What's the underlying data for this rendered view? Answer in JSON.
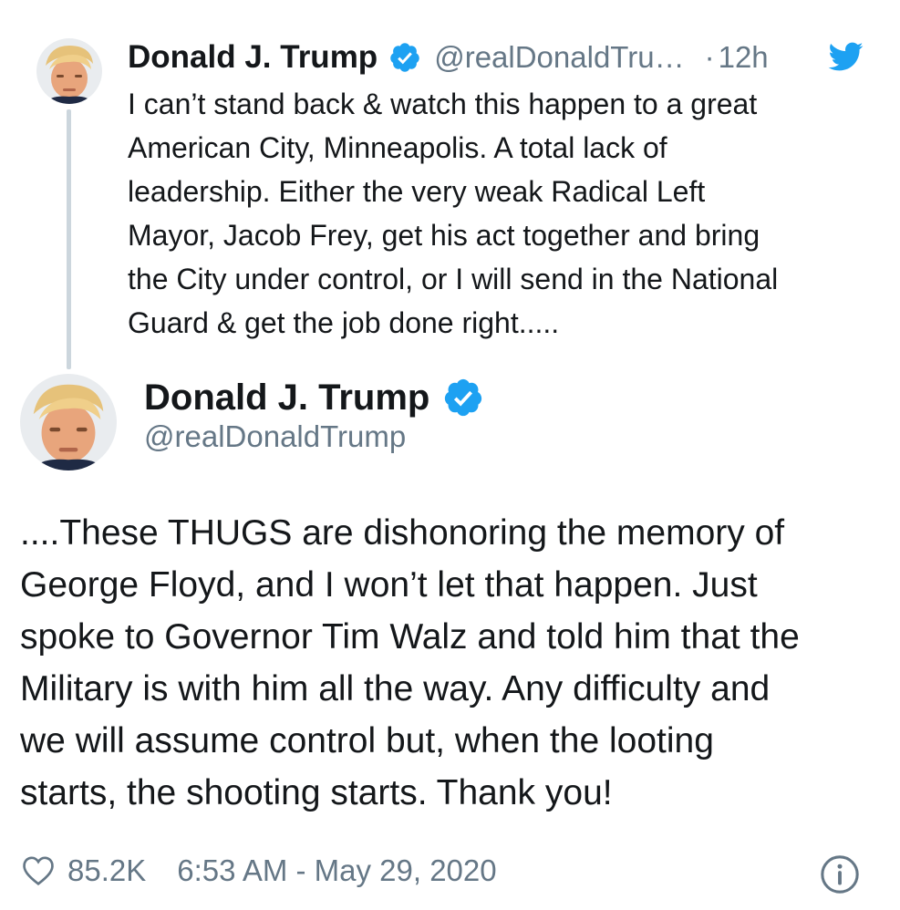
{
  "parent_tweet": {
    "display_name": "Donald J. Trump",
    "handle": "@realDonaldTru…",
    "separator": "·",
    "time_ago": "12h",
    "text": "I can’t stand back & watch this happen to a great\nAmerican City, Minneapolis. A total lack of\nleadership. Either the very weak Radical Left\nMayor, Jacob Frey, get his act together and bring\nthe City under control, or I will send in the National\nGuard & get the job done right....."
  },
  "main_tweet": {
    "display_name": "Donald J. Trump",
    "handle": "@realDonaldTrump",
    "text": "....These THUGS are dishonoring the memory of\nGeorge Floyd, and I won’t let that happen. Just\nspoke to Governor Tim Walz and told him that the\nMilitary is with him all the way. Any difficulty and\nwe will assume control but, when the looting\nstarts, the shooting starts. Thank you!"
  },
  "footer": {
    "like_count": "85.2K",
    "timestamp": "6:53 AM - May 29, 2020"
  },
  "icons": {
    "verified": "verified-badge-icon",
    "twitter": "twitter-bird-icon",
    "heart": "heart-icon",
    "info": "info-icon"
  },
  "colors": {
    "brand_blue": "#1da1f2",
    "text_primary": "#14171a",
    "text_secondary": "#657786",
    "thread_line": "#ccd6dd"
  }
}
